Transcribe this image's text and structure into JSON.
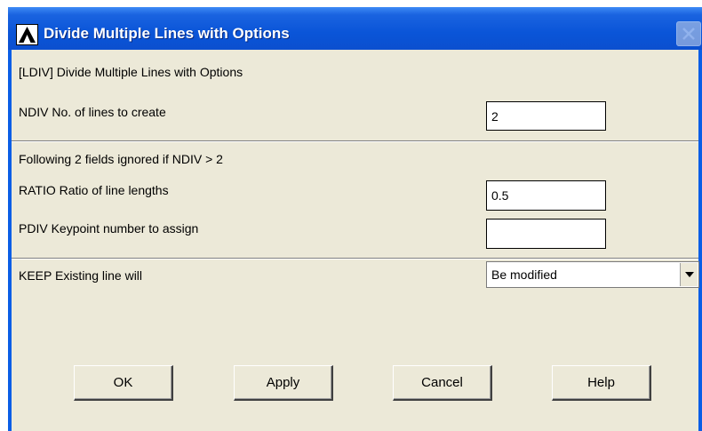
{
  "window": {
    "title": "Divide Multiple Lines with Options"
  },
  "header_text": "[LDIV]  Divide Multiple Lines with Options",
  "fields": {
    "ndiv": {
      "label": "NDIV   No. of lines to create",
      "value": "2"
    },
    "ignored_note": "Following 2 fields ignored if NDIV > 2",
    "ratio": {
      "label": "RATIO  Ratio of line lengths",
      "value": "0.5"
    },
    "pdiv": {
      "label": "PDIV   Keypoint number to assign",
      "value": ""
    },
    "keep": {
      "label": "KEEP  Existing line will",
      "selected": "Be modified"
    }
  },
  "buttons": {
    "ok": "OK",
    "apply": "Apply",
    "cancel": "Cancel",
    "help": "Help"
  },
  "colors": {
    "titlebar": "#0a55d8",
    "dialog_bg": "#ece9d8"
  }
}
